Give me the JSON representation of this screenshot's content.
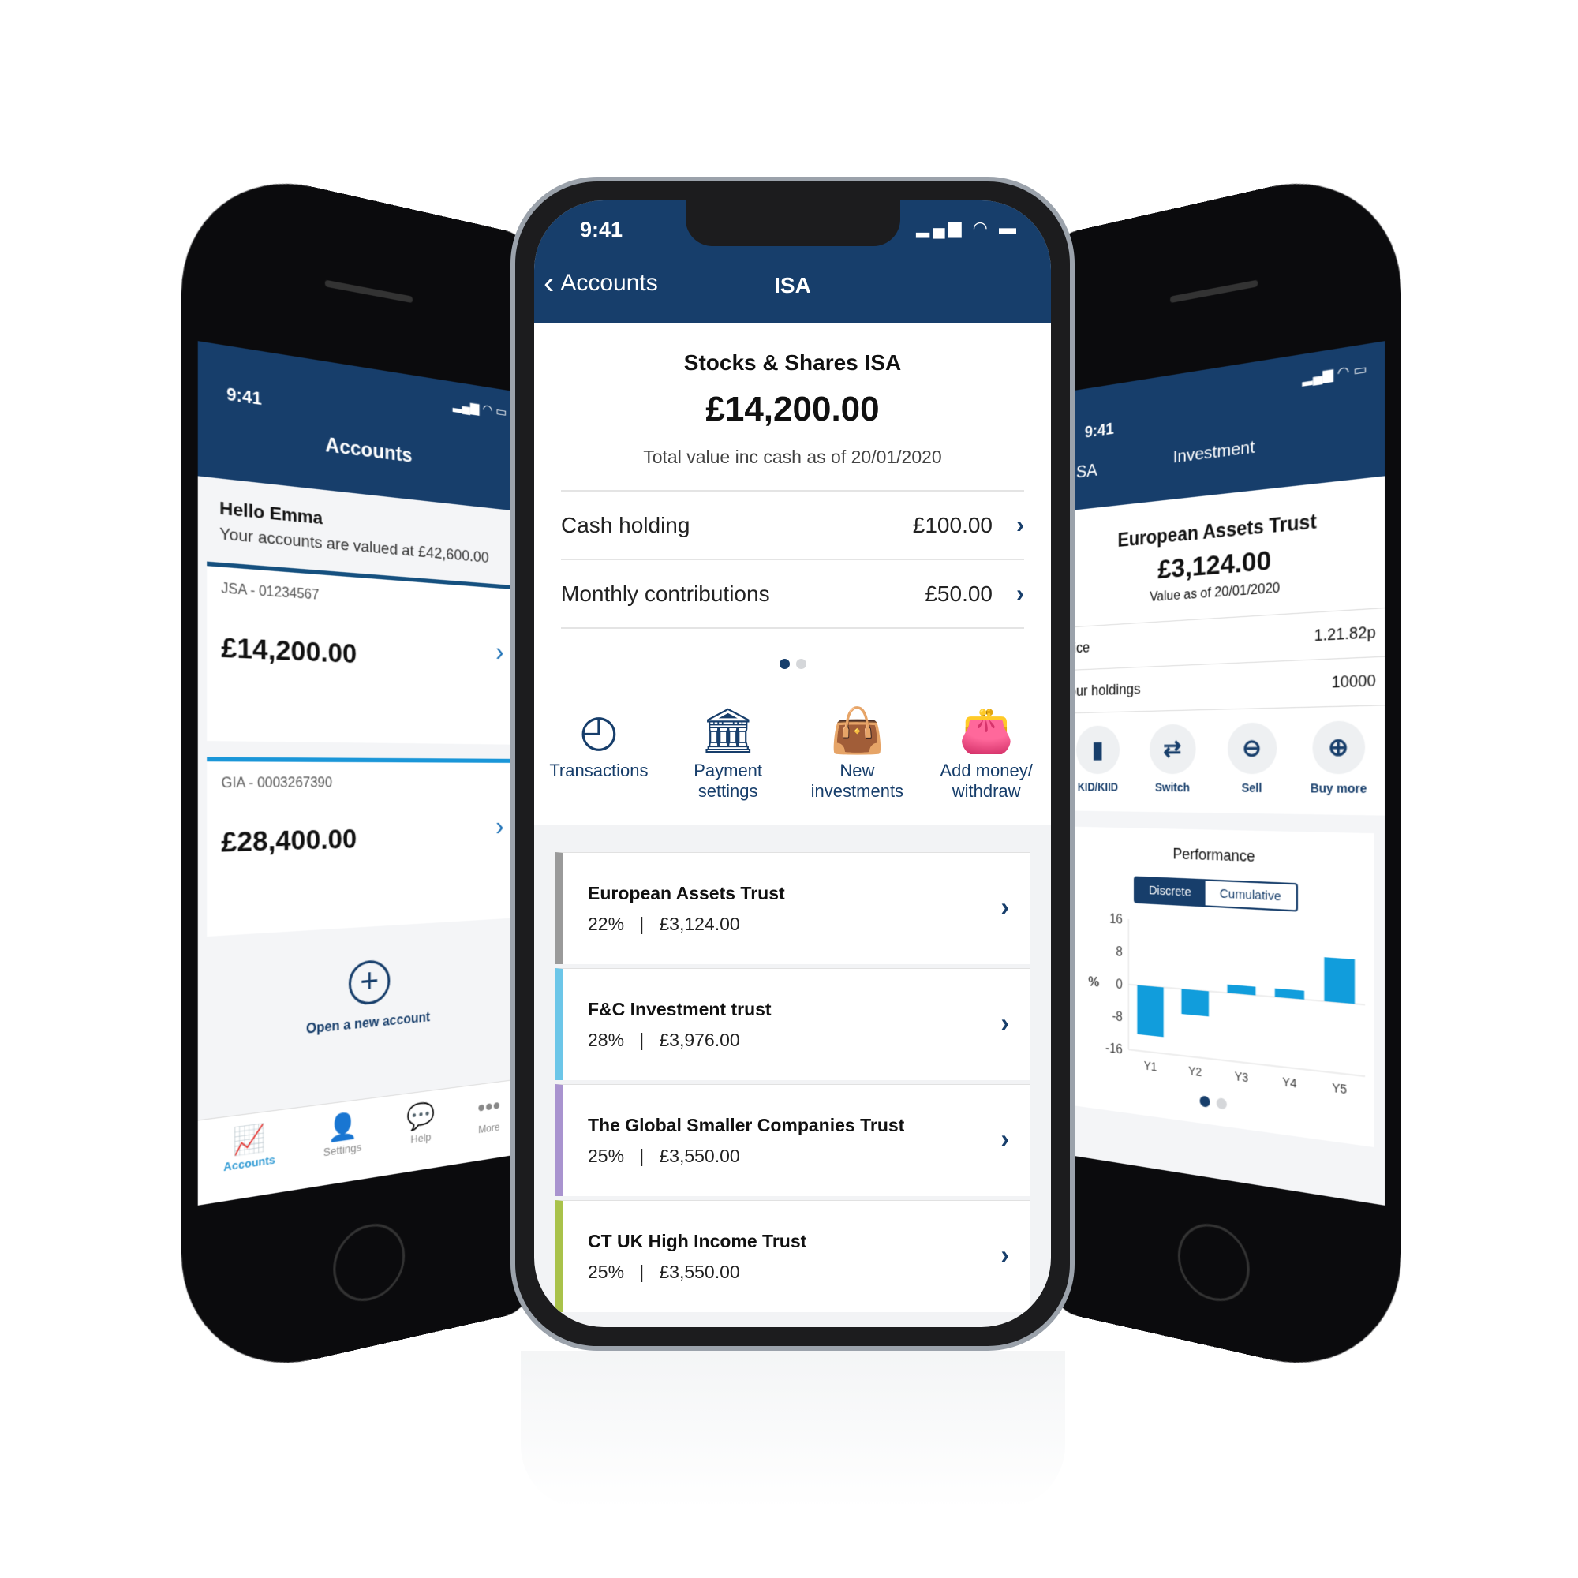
{
  "colors": {
    "brand": "#173e6b",
    "accent": "#1a96d8",
    "bar": "#119ddc"
  },
  "left": {
    "time": "9:41",
    "title": "Accounts",
    "greeting": "Hello Emma",
    "valued": "Your accounts are valued at £42,600.00",
    "accounts": [
      {
        "name": "JSA - 01234567",
        "amount": "£14,200.00"
      },
      {
        "name": "GIA - 0003267390",
        "amount": "£28,400.00"
      }
    ],
    "open_label": "Open a new account",
    "tabs": [
      {
        "label": "Accounts",
        "icon": "chart-icon"
      },
      {
        "label": "Settings",
        "icon": "user-icon"
      },
      {
        "label": "Help",
        "icon": "chat-icon"
      },
      {
        "label": "More",
        "icon": "more-icon"
      }
    ]
  },
  "center": {
    "time": "9:41",
    "back_label": "Accounts",
    "title": "ISA",
    "summary_title": "Stocks & Shares ISA",
    "amount": "£14,200.00",
    "subtitle": "Total value inc cash as of 20/01/2020",
    "rows": [
      {
        "label": "Cash holding",
        "value": "£100.00"
      },
      {
        "label": "Monthly contributions",
        "value": "£50.00"
      }
    ],
    "actions": [
      {
        "l1": "Transactions",
        "l2": "",
        "icon": "clock-icon"
      },
      {
        "l1": "Payment",
        "l2": "settings",
        "icon": "bank-settings-icon"
      },
      {
        "l1": "New",
        "l2": "investments",
        "icon": "shopping-bag-icon"
      },
      {
        "l1": "Add money/",
        "l2": "withdraw",
        "icon": "wallet-icon"
      }
    ],
    "holdings": [
      {
        "name": "European Assets Trust",
        "pct": "22%",
        "value": "£3,124.00",
        "color": "#9a9a9a"
      },
      {
        "name": "F&C Investment trust",
        "pct": "28%",
        "value": "£3,976.00",
        "color": "#6cc6e8"
      },
      {
        "name": "The Global Smaller Companies Trust",
        "pct": "25%",
        "value": "£3,550.00",
        "color": "#a993cf"
      },
      {
        "name": "CT  UK High Income Trust",
        "pct": "25%",
        "value": "£3,550.00",
        "color": "#a9c24a"
      }
    ]
  },
  "right": {
    "time": "9:41",
    "back": "ISA",
    "title": "Investment",
    "name": "European Assets Trust",
    "amount": "£3,124.00",
    "subtitle": "Value as of 20/01/2020",
    "rows": [
      {
        "label": "rice",
        "value": "1.21.82p"
      },
      {
        "label": "our holdings",
        "value": "10000"
      }
    ],
    "actions": [
      {
        "label": "KID/KIID",
        "icon": "document-icon"
      },
      {
        "label": "Switch",
        "icon": "switch-arrows-icon"
      },
      {
        "label": "Sell",
        "icon": "minus-circle-icon"
      },
      {
        "label": "Buy more",
        "icon": "plus-circle-icon"
      }
    ],
    "perf_title": "Performance",
    "seg": [
      "Discrete",
      "Cumulative"
    ]
  },
  "chart_data": {
    "type": "bar",
    "categories": [
      "Y1",
      "Y2",
      "Y3",
      "Y4",
      "Y5"
    ],
    "values": [
      -12,
      -6,
      2,
      2,
      10
    ],
    "ylabel": "%",
    "ylim": [
      -16,
      16
    ],
    "yticks": [
      "16",
      "8",
      "0",
      "-8",
      "-16"
    ]
  }
}
